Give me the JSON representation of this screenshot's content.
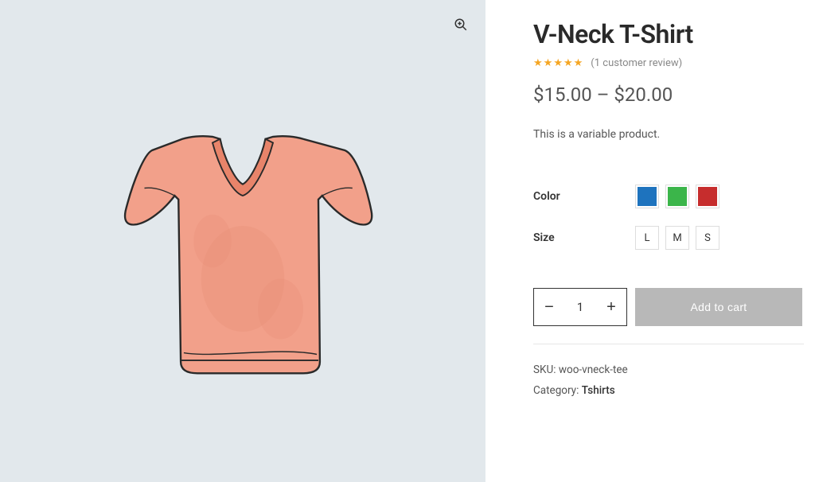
{
  "product": {
    "title": "V-Neck T-Shirt",
    "rating_stars": 5,
    "review_text": "(1 customer review)",
    "price_display": "$15.00 – $20.00",
    "description": "This is a variable product.",
    "sku_label": "SKU:",
    "sku_value": "woo-vneck-tee",
    "category_label": "Category:",
    "category_value": "Tshirts"
  },
  "variants": {
    "color_label": "Color",
    "size_label": "Size",
    "colors": [
      {
        "name": "blue",
        "hex": "#1e73be"
      },
      {
        "name": "green",
        "hex": "#3bb54a"
      },
      {
        "name": "red",
        "hex": "#c62d2d"
      }
    ],
    "sizes": [
      "L",
      "M",
      "S"
    ]
  },
  "cart": {
    "quantity": "1",
    "add_label": "Add to cart"
  }
}
